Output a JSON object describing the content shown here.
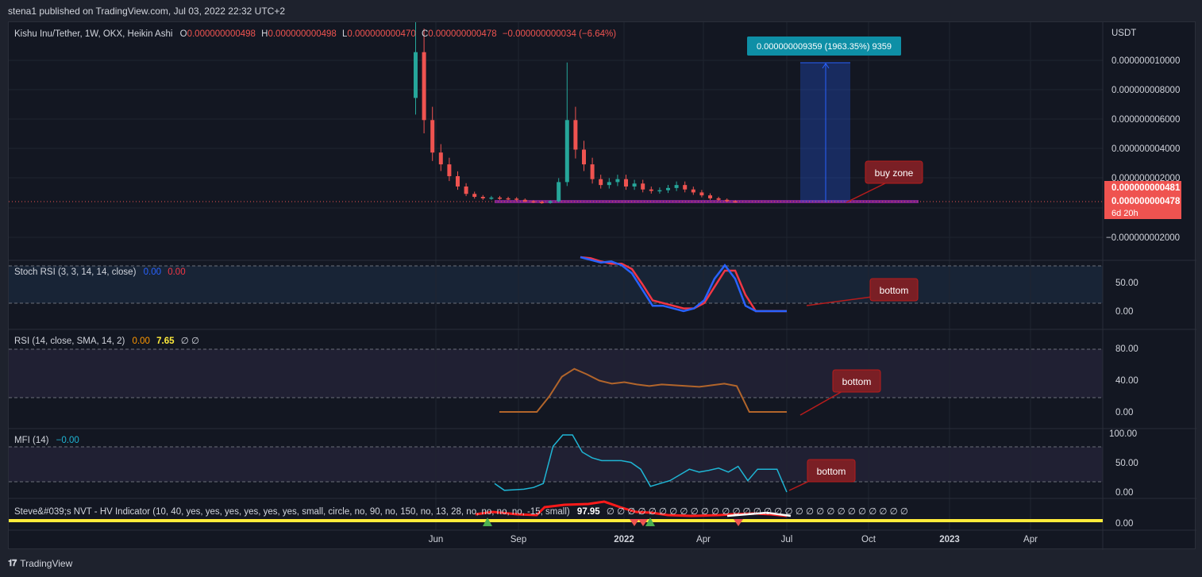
{
  "header": {
    "published": "stena1 published on TradingView.com, Jul 03, 2022 22:32 UTC+2"
  },
  "footer": {
    "brand": "TradingView",
    "logo": "tradingview-logo-icon"
  },
  "main": {
    "symbol": "Kishu Inu/Tether, 1W, OKX, Heikin Ashi",
    "o_label": "O",
    "o_value": "0.000000000498",
    "h_label": "H",
    "h_value": "0.000000000498",
    "l_label": "L",
    "l_value": "0.000000000470",
    "c_label": "C",
    "c_value": "0.000000000478",
    "change": "−0.000000000034 (−6.64%)",
    "currency": "USDT",
    "ticks": [
      "0.000000010000",
      "0.000000008000",
      "0.000000006000",
      "0.000000004000",
      "0.000000002000",
      "−0.000000002000"
    ],
    "price_tag_1": "0.000000000481",
    "price_tag_2": "0.000000000478",
    "countdown": "6d 20h",
    "measure_label": "0.000000009359 (1963.35%) 9359",
    "callout": "buy zone"
  },
  "stoch": {
    "title": "Stoch RSI (3, 3, 14, 14, close)",
    "k": "0.00",
    "d": "0.00",
    "ticks": [
      "50.00",
      "0.00"
    ],
    "callout": "bottom"
  },
  "rsi": {
    "title": "RSI (14, close, SMA, 14, 2)",
    "v1": "0.00",
    "v2": "7.65",
    "v3": "∅ ∅",
    "ticks": [
      "80.00",
      "40.00",
      "0.00"
    ],
    "callout": "bottom"
  },
  "mfi": {
    "title": "MFI (14)",
    "value": "−0.00",
    "ticks": [
      "100.00",
      "50.00",
      "0.00"
    ],
    "callout": "bottom"
  },
  "nvt": {
    "title": "Steve&#039;s NVT - HV Indicator (10, 40, yes, yes, yes, yes, yes, yes, small, circle, no, 90, no, 150, no, 13, 28, no, no, no, no, -15, small)",
    "value": "97.95",
    "empties": "∅ ∅ ∅ ∅ ∅ ∅ ∅ ∅ ∅ ∅ ∅ ∅ ∅ ∅ ∅ ∅ ∅ ∅ ∅ ∅ ∅ ∅ ∅ ∅ ∅ ∅ ∅ ∅ ∅",
    "ticks": [
      "0.00"
    ]
  },
  "time_axis": [
    "Jun",
    "Sep",
    "2022",
    "Apr",
    "Jul",
    "Oct",
    "2023",
    "Apr"
  ],
  "colors": {
    "up": "#26a69a",
    "down": "#ef5350",
    "bg": "#131722",
    "stoch_k": "#2962ff",
    "stoch_d": "#f23645",
    "rsi": "#b2652b",
    "mfi": "#1fb5d4",
    "callout": "#7a1f25",
    "nvt_line": "#ffeb3b"
  },
  "chart_data": {
    "type": "candlestick",
    "price_series": [
      10.6,
      6.0,
      3.8,
      3.0,
      2.2,
      1.5,
      1.0,
      0.8,
      0.7,
      0.75,
      0.7,
      0.68,
      0.6,
      0.5,
      0.45,
      0.4,
      0.5,
      1.5,
      6.0,
      4.0,
      3.0,
      2.0,
      1.6,
      1.8,
      2.0,
      1.5,
      1.7,
      1.3,
      1.2,
      1.25,
      1.4,
      1.6,
      1.3,
      1.1,
      0.9,
      0.7,
      0.6,
      0.5,
      0.48
    ],
    "stoch_k": [
      100,
      95,
      90,
      92,
      85,
      70,
      40,
      10,
      10,
      5,
      0,
      5,
      20,
      60,
      85,
      60,
      10,
      0,
      0,
      0,
      0
    ],
    "stoch_d": [
      100,
      98,
      92,
      88,
      88,
      78,
      50,
      20,
      15,
      10,
      5,
      5,
      15,
      45,
      75,
      75,
      30,
      0,
      0,
      0,
      0
    ],
    "rsi": [
      0,
      0,
      0,
      0,
      20,
      45,
      55,
      48,
      40,
      36,
      38,
      35,
      33,
      35,
      34,
      33,
      32,
      34,
      36,
      33,
      0,
      0,
      0,
      0
    ],
    "mfi": [
      15,
      3,
      4,
      5,
      8,
      15,
      80,
      100,
      100,
      70,
      60,
      55,
      55,
      55,
      52,
      40,
      10,
      15,
      20,
      30,
      40,
      35,
      38,
      42,
      35,
      45,
      20,
      40,
      40,
      40,
      0
    ],
    "measure": {
      "from": 4.78e-10,
      "to": 9.837e-09,
      "change": 9.359e-09,
      "change_pct": 1963.35,
      "bars": 9359
    }
  }
}
